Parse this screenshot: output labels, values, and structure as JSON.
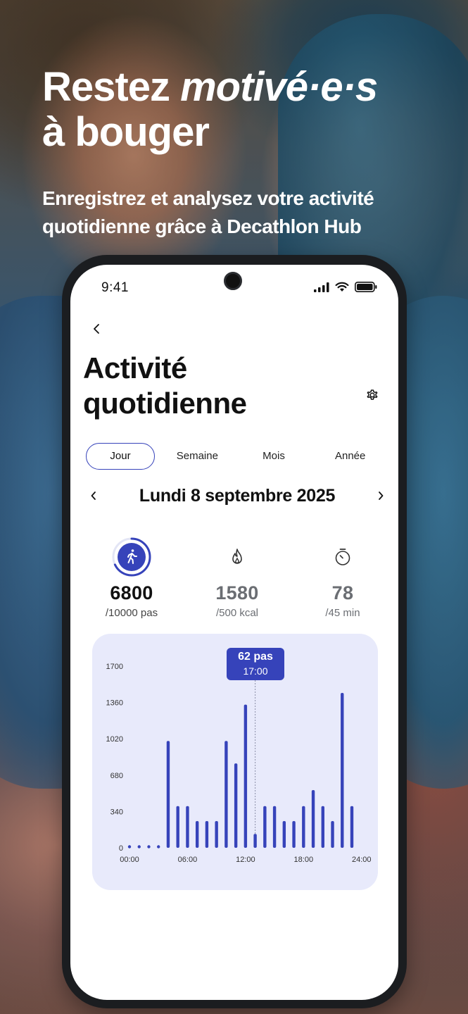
{
  "marketing": {
    "headline_line1_a": "Restez ",
    "headline_line1_b": "motivé·e·s",
    "headline_line2": "à bouger",
    "subhead": "Enregistrez et analysez votre activité quotidienne grâce à Decathlon Hub"
  },
  "status_bar": {
    "time": "9:41",
    "icons": [
      "signal-icon",
      "wifi-icon",
      "battery-icon"
    ]
  },
  "page": {
    "title": "Activité quotidienne",
    "back_icon": "chevron-left-icon",
    "settings_icon": "gear-icon"
  },
  "tabs": [
    {
      "label": "Jour",
      "active": true
    },
    {
      "label": "Semaine",
      "active": false
    },
    {
      "label": "Mois",
      "active": false
    },
    {
      "label": "Année",
      "active": false
    }
  ],
  "date": {
    "label": "Lundi 8 septembre 2025",
    "prev_icon": "chevron-left-icon",
    "next_icon": "chevron-right-icon"
  },
  "stats": [
    {
      "icon": "walking-icon",
      "value": "6800",
      "goal": "/10000 pas",
      "progress": 0.68
    },
    {
      "icon": "flame-icon",
      "value": "1580",
      "goal": "/500 kcal"
    },
    {
      "icon": "stopwatch-icon",
      "value": "78",
      "goal": "/45 min"
    }
  ],
  "colors": {
    "accent": "#3643ba",
    "chart_bg": "#e8eafb",
    "text": "#111111",
    "muted": "#6b6e73"
  },
  "chart_data": {
    "type": "bar",
    "y_ticks": [
      "1700",
      "1360",
      "1020",
      "680",
      "340",
      "0"
    ],
    "x_ticks": [
      "00:00",
      "06:00",
      "12:00",
      "18:00",
      "24:00"
    ],
    "ylim": [
      0,
      1700
    ],
    "values": [
      18,
      18,
      18,
      18,
      1000,
      390,
      390,
      250,
      250,
      250,
      1000,
      790,
      1340,
      130,
      390,
      390,
      250,
      250,
      390,
      540,
      390,
      250,
      1450,
      390
    ],
    "tooltip": {
      "value": "62 pas",
      "time": "17:00",
      "bar_index": 13
    }
  }
}
